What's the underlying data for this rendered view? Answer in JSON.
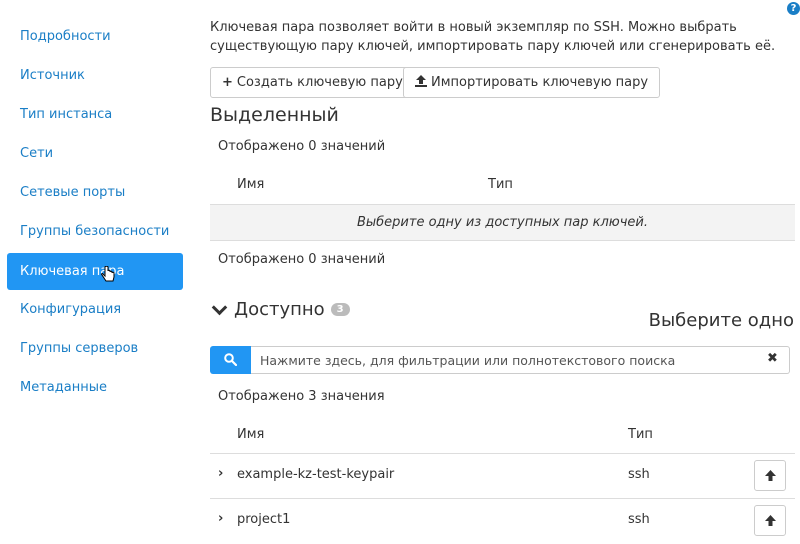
{
  "sidebar": {
    "items": [
      {
        "label": "Подробности",
        "active": false
      },
      {
        "label": "Источник",
        "active": false
      },
      {
        "label": "Тип инстанса",
        "active": false
      },
      {
        "label": "Сети",
        "active": false
      },
      {
        "label": "Сетевые порты",
        "active": false
      },
      {
        "label": "Группы безопасности",
        "active": false
      },
      {
        "label": "Ключевая пара",
        "active": true
      },
      {
        "label": "Конфигурация",
        "active": false
      },
      {
        "label": "Группы серверов",
        "active": false
      },
      {
        "label": "Метаданные",
        "active": false
      }
    ]
  },
  "help": {
    "glyph": "?"
  },
  "description": "Ключевая пара позволяет войти в новый экземпляр по SSH. Можно выбрать существующую пару ключей, импортировать пару ключей или сгенерировать её.",
  "buttons": {
    "create_label": "Создать ключевую пару",
    "create_icon": "+",
    "import_label": "Импортировать ключевую пару"
  },
  "selected": {
    "title": "Выделенный",
    "count_top": "Отображено 0 значений",
    "col_name": "Имя",
    "col_type": "Тип",
    "empty_text": "Выберите одну из доступных пар ключей.",
    "count_bottom": "Отображено 0 значений"
  },
  "available": {
    "title": "Доступно",
    "badge": "3",
    "choose_label": "Выберите одно",
    "search_placeholder": "Нажмите здесь, для фильтрации или полнотекстового поиска",
    "clear_glyph": "✖",
    "count": "Отображено 3 значения",
    "col_name": "Имя",
    "col_type": "Тип",
    "rows": [
      {
        "caret": "›",
        "name": "example-kz-test-keypair",
        "type": "ssh"
      },
      {
        "caret": "›",
        "name": "project1",
        "type": "ssh"
      }
    ]
  },
  "colors": {
    "accent": "#2196f3",
    "link": "#1a7ec6"
  }
}
